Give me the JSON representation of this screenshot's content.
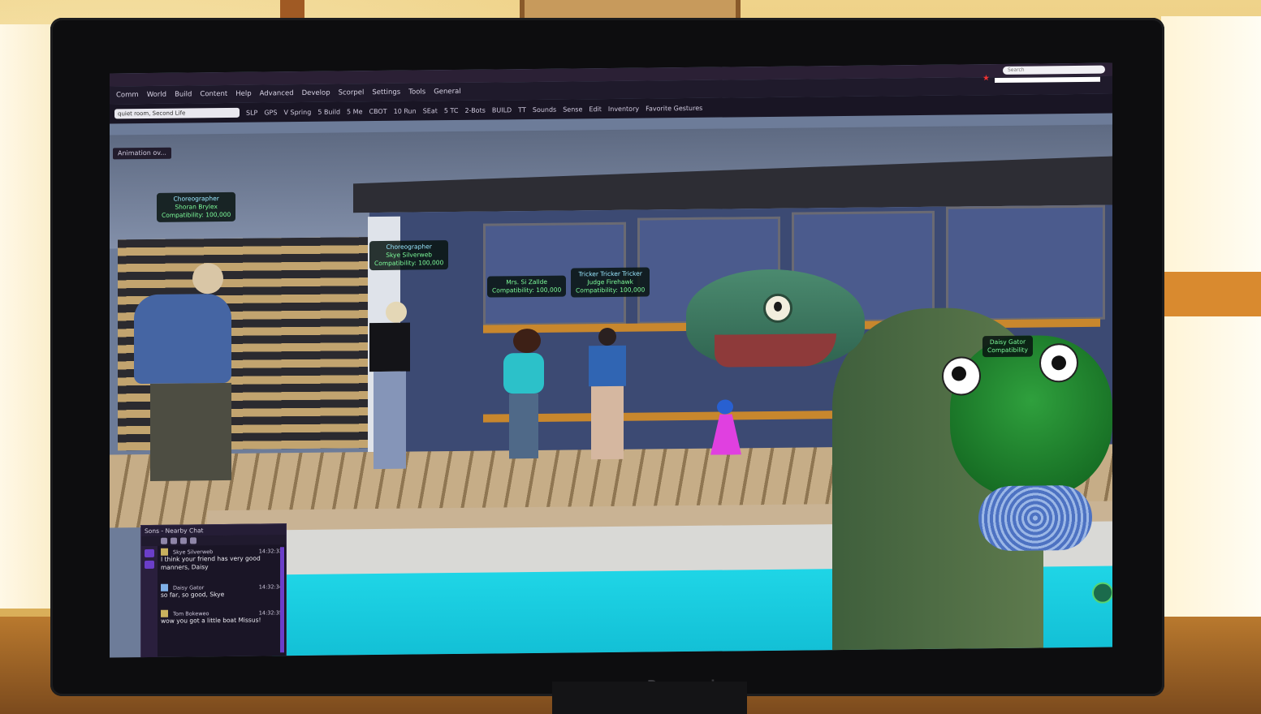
{
  "viewer": {
    "menu": [
      "Comm",
      "World",
      "Build",
      "Content",
      "Help",
      "Advanced",
      "Develop",
      "Scorpel",
      "Settings",
      "Tools",
      "General",
      "Help"
    ],
    "address_value": "quiet room, Second Life",
    "toolbar_items": [
      "SLP",
      "GPS",
      "V Spring",
      "5 Build",
      "5 Me",
      "CBOT",
      "10 Run",
      "SEat",
      "5 TC",
      "2-Bots",
      "BUILD",
      "TT",
      "Sounds",
      "Sense",
      "Edit",
      "Inventory",
      "Favorite Gestures"
    ],
    "search_placeholder": "Search",
    "animation_panel": "Animation ov...",
    "brand": "Panasonic"
  },
  "nametags": [
    {
      "role": "Choreographer",
      "name": "Shoran Brylex",
      "line": "Compatibility: 100,000"
    },
    {
      "role": "Choreographer",
      "name": "Skye Silverweb",
      "line": "Compatibility: 100,000"
    },
    {
      "role": "",
      "name": "Mrs. Si Zallde",
      "line": "Compatibility: 100,000"
    },
    {
      "role": "Tricker Tricker Tricker",
      "name": "Judge Firehawk",
      "line": "Compatibility: 100,000"
    },
    {
      "role": "",
      "name": "Daisy Gator",
      "line": "Compatibility"
    }
  ],
  "chat": {
    "title": "Sons - Nearby Chat",
    "messages": [
      {
        "name": "Skye Silverweb",
        "time": "14:32:32",
        "text": "I think your friend has very good manners, Daisy"
      },
      {
        "name": "Daisy Gator",
        "time": "14:32:34",
        "text": "so far, so good, Skye"
      },
      {
        "name": "Tom Bokeweo",
        "time": "14:32:35",
        "text": "wow you got a little boat Missus!"
      }
    ]
  },
  "colors": {
    "nametag_green": "#7dfc9a",
    "pool": "#1fd5e6",
    "viewer_chrome": "#1f1a2b",
    "accent": "#6b3ec9"
  }
}
